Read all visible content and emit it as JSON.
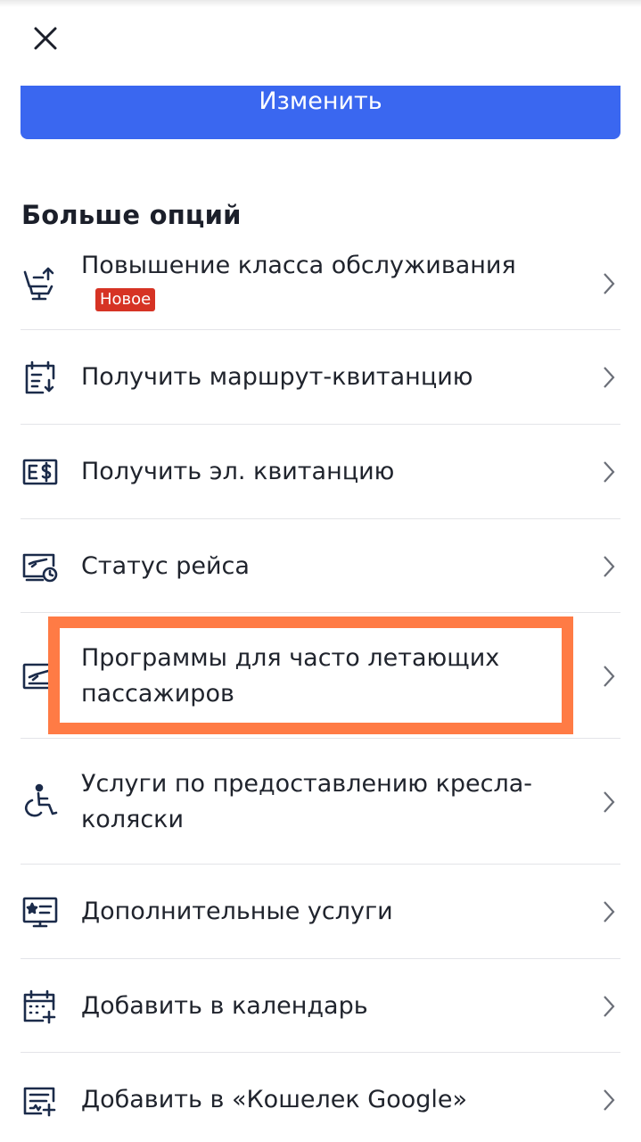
{
  "header": {
    "close_icon": "close-icon",
    "change_button_label": "Изменить"
  },
  "colors": {
    "primary": "#3a67f0",
    "badge": "#d63324",
    "highlight": "#ff7b45",
    "icon": "#1b2b4a"
  },
  "more_options": {
    "title": "Больше опций",
    "items": [
      {
        "label": "Повышение класса обслуживания",
        "badge": "Новое",
        "icon": "seat-upgrade-icon"
      },
      {
        "label": "Получить маршрут-квитанцию",
        "icon": "itinerary-download-icon"
      },
      {
        "label": "Получить эл. квитанцию",
        "icon": "e-receipt-icon"
      },
      {
        "label": "Статус рейса",
        "icon": "flight-status-icon"
      },
      {
        "label": "Программы для часто летающих пассажиров",
        "icon": "frequent-flyer-icon",
        "highlighted": true
      },
      {
        "label": "Услуги по предоставлению кресла-коляски",
        "icon": "wheelchair-icon"
      },
      {
        "label": "Дополнительные услуги",
        "icon": "extra-services-icon"
      },
      {
        "label": "Добавить в календарь",
        "icon": "add-calendar-icon"
      },
      {
        "label": "Добавить в «Кошелек Google»",
        "icon": "google-wallet-icon"
      }
    ]
  }
}
